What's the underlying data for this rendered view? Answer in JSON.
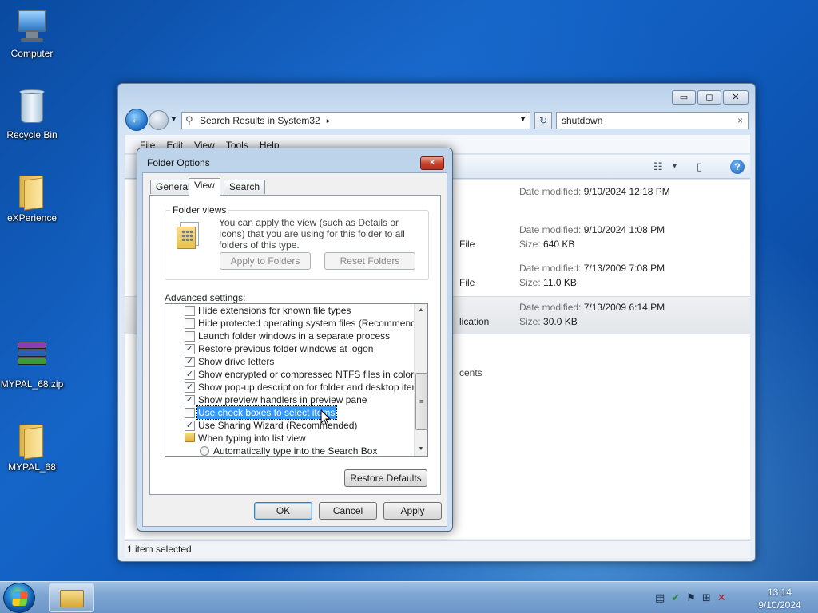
{
  "desktop": {
    "icons": [
      {
        "label": "Computer"
      },
      {
        "label": "Recycle Bin"
      },
      {
        "label": "eXPerience"
      },
      {
        "label": "MYPAL_68.zip"
      },
      {
        "label": "MYPAL_68"
      }
    ]
  },
  "explorer": {
    "caption_buttons": {
      "minimize": "▭",
      "maximize": "◻",
      "close": "✕"
    },
    "address": {
      "path": "Search Results in System32",
      "separator": "▸"
    },
    "search": {
      "value": "shutdown",
      "clear": "×"
    },
    "menu": [
      "File",
      "Edit",
      "View",
      "Tools",
      "Help"
    ],
    "toolbar": {
      "view_icon": "☷",
      "view_drop": "▾",
      "pane_icon": "▯",
      "help_icon": "?"
    },
    "results": [
      {
        "kind": "",
        "date_label": "Date modified:",
        "date": "9/10/2024 12:18 PM",
        "size_label": "",
        "size": ""
      },
      {
        "kind": "File",
        "date_label": "Date modified:",
        "date": "9/10/2024 1:08 PM",
        "size_label": "Size:",
        "size": "640 KB"
      },
      {
        "kind": "File",
        "date_label": "Date modified:",
        "date": "7/13/2009 7:08 PM",
        "size_label": "Size:",
        "size": "11.0 KB"
      },
      {
        "kind": "lication",
        "date_label": "Date modified:",
        "date": "7/13/2009 6:14 PM",
        "size_label": "Size:",
        "size": "30.0 KB"
      }
    ],
    "extra_text": "cents",
    "status": "1 item selected"
  },
  "dialog": {
    "title": "Folder Options",
    "close": "✕",
    "tabs": [
      "General",
      "View",
      "Search"
    ],
    "active_tab": "View",
    "folder_views": {
      "legend": "Folder views",
      "description": "You can apply the view (such as Details or Icons) that you are using for this folder to all folders of this type.",
      "apply_button": "Apply to Folders",
      "reset_button": "Reset Folders"
    },
    "advanced_label": "Advanced settings:",
    "advanced_items": [
      {
        "type": "checkbox",
        "checked": false,
        "label": "Hide extensions for known file types"
      },
      {
        "type": "checkbox",
        "checked": false,
        "label": "Hide protected operating system files (Recommended)"
      },
      {
        "type": "checkbox",
        "checked": false,
        "label": "Launch folder windows in a separate process"
      },
      {
        "type": "checkbox",
        "checked": true,
        "label": "Restore previous folder windows at logon"
      },
      {
        "type": "checkbox",
        "checked": true,
        "label": "Show drive letters"
      },
      {
        "type": "checkbox",
        "checked": true,
        "label": "Show encrypted or compressed NTFS files in color"
      },
      {
        "type": "checkbox",
        "checked": true,
        "label": "Show pop-up description for folder and desktop items"
      },
      {
        "type": "checkbox",
        "checked": true,
        "label": "Show preview handlers in preview pane"
      },
      {
        "type": "checkbox",
        "checked": false,
        "label": "Use check boxes to select items",
        "highlighted": true
      },
      {
        "type": "checkbox",
        "checked": true,
        "label": "Use Sharing Wizard (Recommended)"
      },
      {
        "type": "folder",
        "label": "When typing into list view"
      },
      {
        "type": "radio",
        "checked": false,
        "label": "Automatically type into the Search Box"
      }
    ],
    "check_mark": "✓",
    "restore_defaults": "Restore Defaults",
    "ok": "OK",
    "cancel": "Cancel",
    "apply": "Apply"
  },
  "taskbar": {
    "clock_time": "13:14",
    "clock_date": "9/10/2024",
    "tray_icons": [
      "document-icon",
      "shield-check-icon",
      "flag-icon",
      "network-icon",
      "speaker-muted-icon"
    ]
  }
}
